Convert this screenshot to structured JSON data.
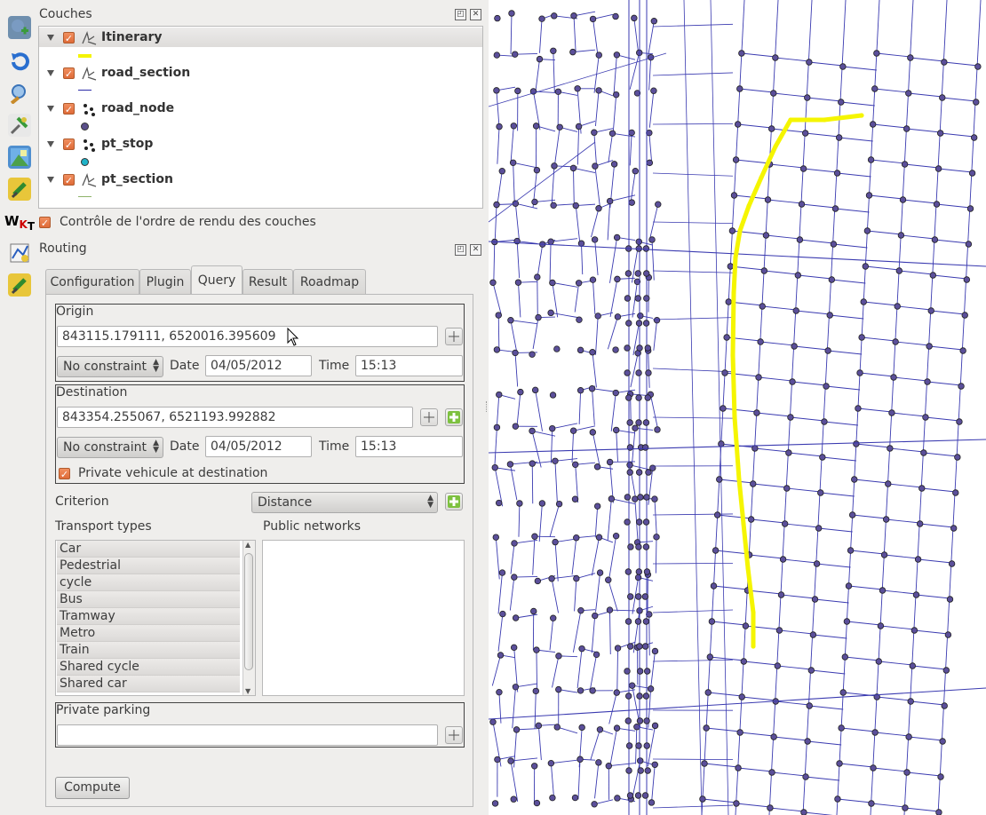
{
  "layers_panel": {
    "title": "Couches",
    "layers": [
      {
        "name": "Itinerary",
        "checked": true,
        "symbol_color": "#f4f400",
        "icon": "line-layer-icon"
      },
      {
        "name": "road_section",
        "checked": true,
        "symbol_color": "#2b2ba8",
        "icon": "line-layer-icon"
      },
      {
        "name": "road_node",
        "checked": true,
        "symbol_color": "#5a4f8a",
        "icon": "point-layer-icon"
      },
      {
        "name": "pt_stop",
        "checked": true,
        "symbol_color": "#1fb3c8",
        "icon": "point-layer-icon"
      },
      {
        "name": "pt_section",
        "checked": true,
        "symbol_color": "#8fb36a",
        "icon": "line-layer-icon"
      }
    ],
    "render_order_label": "Contrôle de l'ordre de rendu des couches",
    "render_order_checked": true
  },
  "routing_panel": {
    "title": "Routing",
    "tabs": [
      "Configuration",
      "Plugin",
      "Query",
      "Result",
      "Roadmap"
    ],
    "active_tab": "Query",
    "origin": {
      "label": "Origin",
      "coords": "843115.179111, 6520016.395609",
      "constraint": "No constraint",
      "date_label": "Date",
      "date": "04/05/2012",
      "time_label": "Time",
      "time": "15:13"
    },
    "destination": {
      "label": "Destination",
      "coords": "843354.255067, 6521193.992882",
      "constraint": "No constraint",
      "date_label": "Date",
      "date": "04/05/2012",
      "time_label": "Time",
      "time": "15:13",
      "private_vehicle_label": "Private vehicule at destination",
      "private_vehicle_checked": true
    },
    "criterion_label": "Criterion",
    "criterion_value": "Distance",
    "transport_types_label": "Transport types",
    "transport_types": [
      "Car",
      "Pedestrial",
      "cycle",
      "Bus",
      "Tramway",
      "Metro",
      "Train",
      "Shared cycle",
      "Shared car"
    ],
    "public_networks_label": "Public networks",
    "private_parking_label": "Private parking",
    "private_parking_value": "",
    "compute_label": "Compute"
  },
  "toolbar": {
    "icons": [
      "add-layer-icon",
      "refresh-icon",
      "zoom-icon",
      "plugin-tools-icon",
      "raster-icon",
      "plugin-icon",
      "wkt-icon",
      "digitize-icon",
      "routing-plugin-icon"
    ]
  },
  "colors": {
    "road": "#3a3ab0",
    "node_fill": "#5b4f9a",
    "itinerary": "#f5f500",
    "checkbox": "#e8794a"
  }
}
